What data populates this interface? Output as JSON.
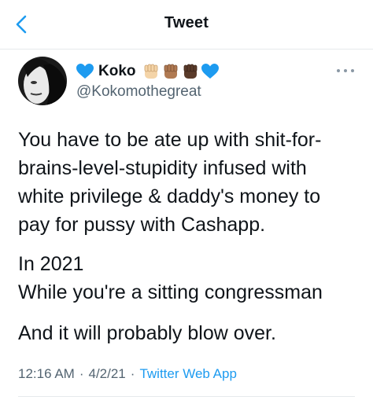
{
  "header": {
    "title": "Tweet",
    "back_icon": "chevron-left-icon",
    "accent": "#1d9bf0"
  },
  "author": {
    "display_name": "Koko",
    "handle": "@Kokomothegreat",
    "emojis": [
      "blue-heart-icon",
      "raised-fist-light-icon",
      "raised-fist-medium-icon",
      "raised-fist-dark-icon",
      "blue-heart-icon"
    ]
  },
  "tweet": {
    "paragraph1": "You have to be ate up with shit-for-brains-level-stupidity infused with white privilege & daddy's money to pay for pussy with Cashapp.",
    "paragraph2": "In 2021\nWhile you're a sitting congressman",
    "paragraph3": "And it will probably blow over."
  },
  "meta": {
    "time": "12:16 AM",
    "date": "4/2/21",
    "separator": "·",
    "client": "Twitter Web App"
  },
  "colors": {
    "text": "#0f1419",
    "secondary": "#536471",
    "link": "#1d9bf0",
    "heart": "#1d9bf0"
  }
}
